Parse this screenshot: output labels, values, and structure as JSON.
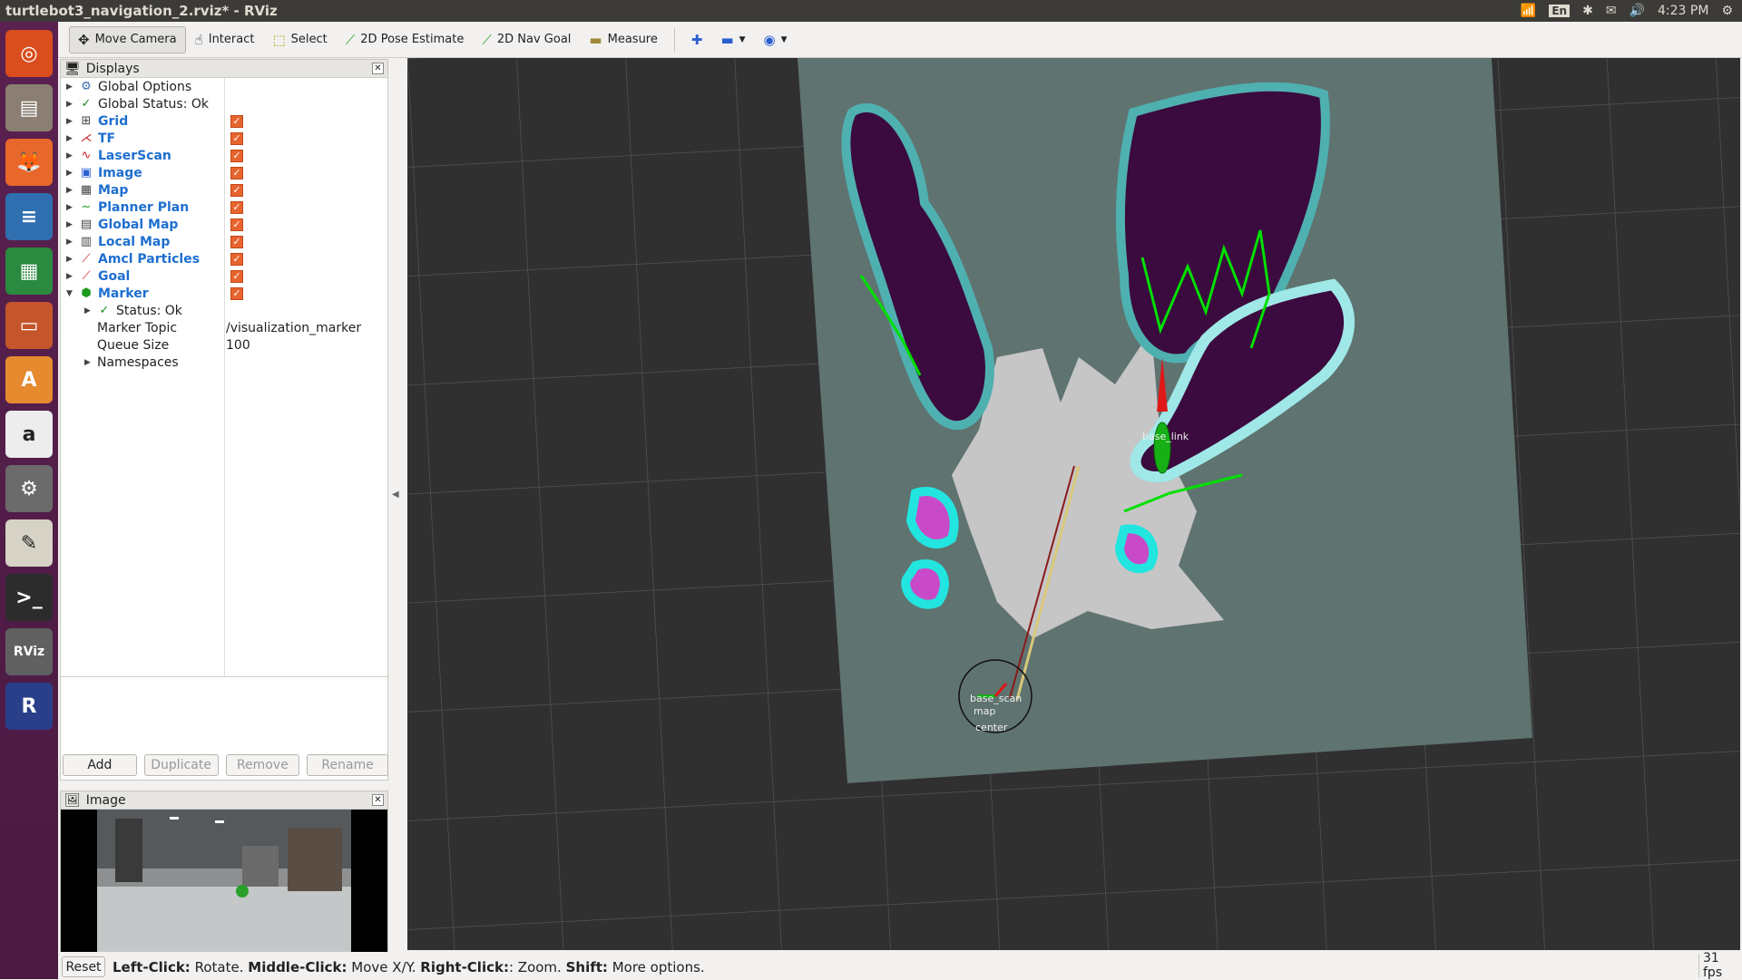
{
  "window": {
    "title": "turtlebot3_navigation_2.rviz* - RViz"
  },
  "tray": {
    "lang": "En",
    "time": "4:23 PM"
  },
  "launcher": [
    {
      "name": "ubuntu-dash-icon",
      "color": "#d94d1e",
      "glyph": "◎"
    },
    {
      "name": "files-icon",
      "color": "#8a7f72",
      "glyph": "▤"
    },
    {
      "name": "firefox-icon",
      "color": "#e8672b",
      "glyph": "🦊"
    },
    {
      "name": "writer-icon",
      "color": "#2f6fb0",
      "glyph": "≡"
    },
    {
      "name": "calc-icon",
      "color": "#2a8a3f",
      "glyph": "▦"
    },
    {
      "name": "impress-icon",
      "color": "#c5552a",
      "glyph": "▭"
    },
    {
      "name": "software-center-icon",
      "color": "#e58a2f",
      "glyph": "A"
    },
    {
      "name": "amazon-icon",
      "color": "#ededed",
      "glyph": "a"
    },
    {
      "name": "settings-icon",
      "color": "#6b6b6b",
      "glyph": "⚙"
    },
    {
      "name": "text-editor-icon",
      "color": "#d6d2c6",
      "glyph": "✎"
    },
    {
      "name": "terminal-icon",
      "color": "#2c2c2c",
      "glyph": ">_"
    },
    {
      "name": "rviz-icon",
      "color": "#606060",
      "glyph": "RViz"
    },
    {
      "name": "r-icon",
      "color": "#2a3f8a",
      "glyph": "R"
    }
  ],
  "toolbar": {
    "move_camera": "Move Camera",
    "interact": "Interact",
    "select": "Select",
    "pose_estimate": "2D Pose Estimate",
    "nav_goal": "2D Nav Goal",
    "measure": "Measure"
  },
  "displays": {
    "title": "Displays",
    "items": [
      {
        "label": "Global Options",
        "checkbox": false,
        "blue": false
      },
      {
        "label": "Global Status: Ok",
        "checkbox": false,
        "blue": false
      },
      {
        "label": "Grid",
        "checkbox": true,
        "blue": true
      },
      {
        "label": "TF",
        "checkbox": true,
        "blue": true
      },
      {
        "label": "LaserScan",
        "checkbox": true,
        "blue": true
      },
      {
        "label": "Image",
        "checkbox": true,
        "blue": true
      },
      {
        "label": "Map",
        "checkbox": true,
        "blue": true
      },
      {
        "label": "Planner Plan",
        "checkbox": true,
        "blue": true
      },
      {
        "label": "Global Map",
        "checkbox": true,
        "blue": true
      },
      {
        "label": "Local Map",
        "checkbox": true,
        "blue": true
      },
      {
        "label": "Amcl Particles",
        "checkbox": true,
        "blue": true
      },
      {
        "label": "Goal",
        "checkbox": true,
        "blue": true
      },
      {
        "label": "Marker",
        "checkbox": true,
        "blue": true
      }
    ],
    "marker_children": {
      "status": "Status: Ok",
      "topic_label": "Marker Topic",
      "topic_value": "/visualization_marker",
      "queue_label": "Queue Size",
      "queue_value": "100",
      "namespaces": "Namespaces"
    },
    "buttons": {
      "add": "Add",
      "duplicate": "Duplicate",
      "remove": "Remove",
      "rename": "Rename"
    }
  },
  "image_panel": {
    "title": "Image"
  },
  "viewport": {
    "labels": {
      "map": "map",
      "center": "center",
      "base_link": "base_link",
      "robot": "base_scan"
    }
  },
  "statusbar": {
    "reset": "Reset",
    "hint_left_key": "Left-Click:",
    "hint_left": "Rotate.",
    "hint_mid_key": "Middle-Click:",
    "hint_mid": "Move X/Y.",
    "hint_right_key": "Right-Click:",
    "hint_right": ": Zoom.",
    "hint_shift_key": "Shift:",
    "hint_shift": "More options.",
    "fps": "31 fps"
  },
  "colors": {
    "accent": "#e8642f",
    "link_blue": "#1e6fd0",
    "path_green": "#00e000",
    "costmap_purple": "#3b0a3f",
    "inflation_cyan": "#22e5e0"
  }
}
